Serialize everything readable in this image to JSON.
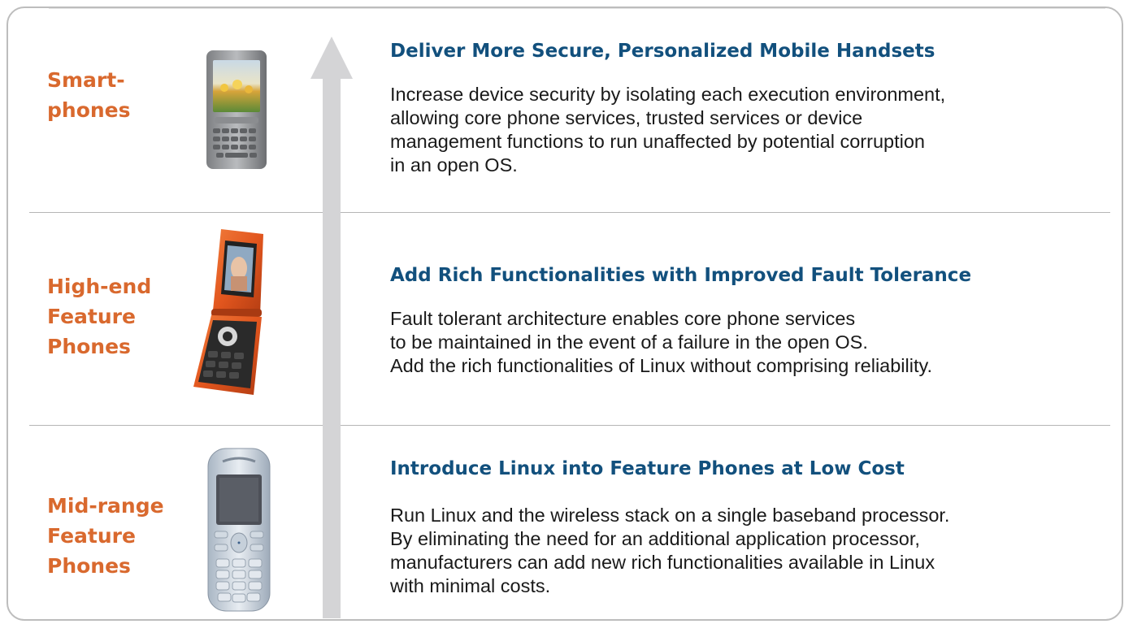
{
  "colors": {
    "label": "#d9692e",
    "heading": "#12507d",
    "body": "#1a1a1a",
    "arrow": "#d4d4d6",
    "border": "#bdbdbd"
  },
  "tiers": [
    {
      "label_lines": [
        "Smart-",
        "phones"
      ],
      "heading": "Deliver More Secure, Personalized Mobile Handsets",
      "body_lines": [
        "Increase device security by isolating each execution environment,",
        "allowing core phone services, trusted services or device",
        "management functions to run unaffected by potential corruption",
        "in an open OS."
      ],
      "phone_icon": "smartphone-icon"
    },
    {
      "label_lines": [
        "High-end",
        "Feature",
        "Phones"
      ],
      "heading": "Add Rich Functionalities with Improved Fault Tolerance",
      "body_lines": [
        "Fault tolerant architecture enables core phone services",
        "to be maintained in the event of a failure in the open OS.",
        "Add the rich functionalities of Linux without comprising reliability."
      ],
      "phone_icon": "flip-phone-icon"
    },
    {
      "label_lines": [
        "Mid-range",
        "Feature",
        "Phones"
      ],
      "heading": "Introduce Linux into Feature Phones at Low Cost",
      "body_lines": [
        "Run Linux and the wireless stack on a single baseband processor.",
        "By eliminating the need for an additional application processor,",
        "manufacturers can add new rich functionalities available in Linux",
        "with minimal costs."
      ],
      "phone_icon": "candybar-phone-icon"
    }
  ]
}
